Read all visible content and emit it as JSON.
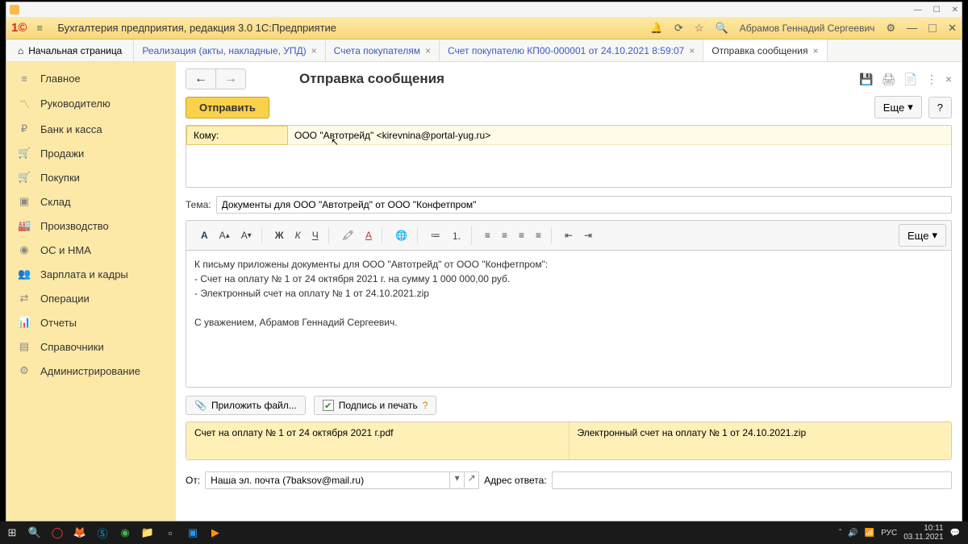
{
  "header": {
    "product_title": "Бухгалтерия предприятия, редакция 3.0 1С:Предприятие",
    "username": "Абрамов Геннадий Сергеевич"
  },
  "tabs": {
    "home": "Начальная страница",
    "t1": "Реализация (акты, накладные, УПД)",
    "t2": "Счета покупателям",
    "t3": "Счет покупателю КП00-000001 от 24.10.2021 8:59:07",
    "t4": "Отправка сообщения"
  },
  "sidebar": {
    "main": "Главное",
    "director": "Руководителю",
    "bank": "Банк и касса",
    "sales": "Продажи",
    "purch": "Покупки",
    "stock": "Склад",
    "prod": "Производство",
    "os": "ОС и НМА",
    "salary": "Зарплата и кадры",
    "ops": "Операции",
    "reports": "Отчеты",
    "refs": "Справочники",
    "admin": "Администрирование"
  },
  "page": {
    "title": "Отправка сообщения",
    "send": "Отправить",
    "more": "Еще",
    "help": "?",
    "to_label": "Кому:",
    "to_value": "ООО \"Автотрейд\" <kirevnina@portal-yug.ru>",
    "subj_label": "Тема:",
    "subj_value": "Документы для ООО \"Автотрейд\" от ООО \"Конфетпром\"",
    "body_l1": "К письму приложены документы для ООО \"Автотрейд\" от ООО \"Конфетпром\":",
    "body_l2": "- Счет на оплату № 1 от 24 октября 2021 г. на сумму 1 000 000,00 руб.",
    "body_l3": "- Электронный счет на оплату № 1 от 24.10.2021.zip",
    "body_l4": "С уважением, Абрамов Геннадий Сергеевич.",
    "attach_btn": "Приложить файл...",
    "sign_btn": "Подпись и печать",
    "att1": "Счет на оплату № 1 от 24 октября 2021 г.pdf",
    "att2": "Электронный счет на оплату № 1 от 24.10.2021.zip",
    "from_label": "От:",
    "from_value": "Наша эл. почта (7baksov@mail.ru)",
    "reply_label": "Адрес ответа:",
    "toolbar_more": "Еще"
  },
  "tray": {
    "lang": "РУС",
    "time": "10:11",
    "date": "03.11.2021"
  }
}
